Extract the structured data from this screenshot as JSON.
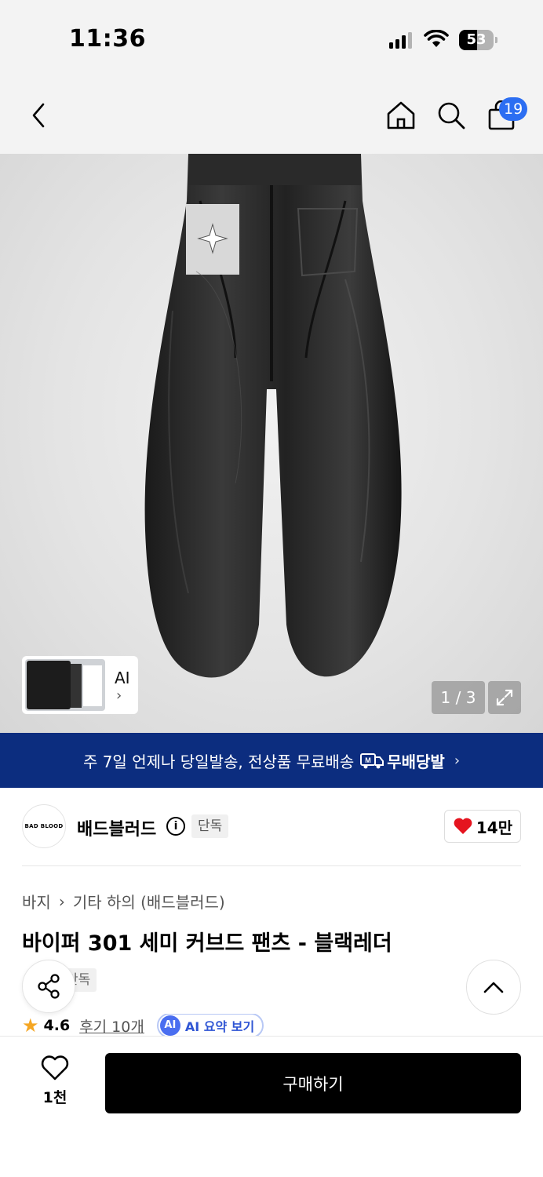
{
  "status_bar": {
    "time": "11:36",
    "battery": "53",
    "battery_level": 0.53
  },
  "header": {
    "cart_count": "19"
  },
  "gallery": {
    "thumb_label": "AI",
    "thumb_arrow": "›",
    "pager": "1 / 3"
  },
  "banner": {
    "text": "주 7일 언제나 당일발송, 전상품 무료배송",
    "free_label": "무배당발",
    "chevron": "›"
  },
  "brand": {
    "logo_text": "BAD BLOOD",
    "name": "배드블러드",
    "info": "i",
    "tag": "단독",
    "likes": "14만"
  },
  "breadcrumb": {
    "level1": "바지",
    "sep": "›",
    "level2": "기타 하의 (배드블러드)"
  },
  "product": {
    "title": "바이퍼 301 세미 커브드 팬츠 - 블랙레더",
    "tag": "단독"
  },
  "rating": {
    "star": "★",
    "score": "4.6",
    "reviews": "후기 10개",
    "ai_badge": "AI",
    "ai_summary": "AI 요약 보기"
  },
  "bottom": {
    "wish_count": "1천",
    "buy_label": "구매하기"
  }
}
